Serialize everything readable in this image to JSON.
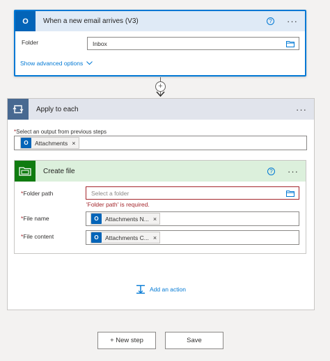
{
  "trigger": {
    "title": "When a new email arrives (V3)",
    "help": "?",
    "menu": "···",
    "folder_label": "Folder",
    "folder_value": "Inbox",
    "show_advanced": "Show advanced options"
  },
  "connector": {
    "plus": "+"
  },
  "apply": {
    "title": "Apply to each",
    "menu": "···",
    "output_label": "Select an output from previous steps",
    "output_token": "Attachments",
    "add_action": "Add an action"
  },
  "create_file": {
    "title": "Create file",
    "help": "?",
    "menu": "···",
    "folder_path_label": "Folder path",
    "folder_path_placeholder": "Select a folder",
    "folder_path_error": "'Folder path' is required.",
    "file_name_label": "File name",
    "file_name_token": "Attachments N...",
    "file_content_label": "File content",
    "file_content_token": "Attachments C..."
  },
  "footer": {
    "new_step": "+ New step",
    "save": "Save"
  },
  "colors": {
    "accent": "#0078d4",
    "outlook": "#0364b8",
    "loop": "#486991",
    "sharepoint": "#107c10",
    "error": "#a4262c"
  }
}
